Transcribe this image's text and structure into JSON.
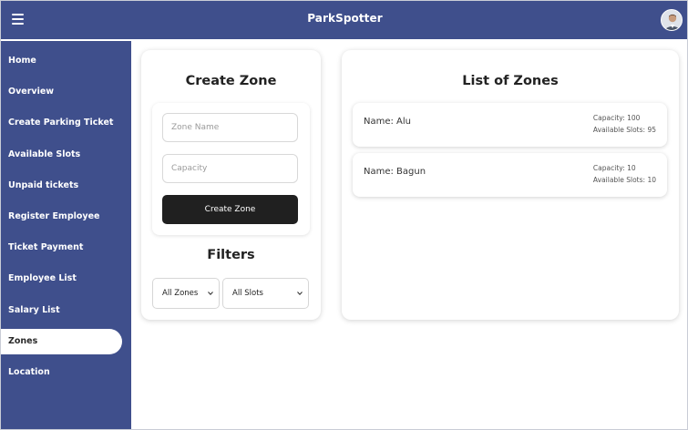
{
  "app": {
    "title": "ParkSpotter"
  },
  "sidebar": {
    "items": [
      {
        "label": "Home",
        "active": false
      },
      {
        "label": "Overview",
        "active": false
      },
      {
        "label": "Create Parking Ticket",
        "active": false
      },
      {
        "label": "Available Slots",
        "active": false
      },
      {
        "label": "Unpaid tickets",
        "active": false
      },
      {
        "label": "Register Employee",
        "active": false
      },
      {
        "label": "Ticket Payment",
        "active": false
      },
      {
        "label": "Employee List",
        "active": false
      },
      {
        "label": "Salary List",
        "active": false
      },
      {
        "label": "Zones",
        "active": true
      },
      {
        "label": "Location",
        "active": false
      }
    ]
  },
  "create_zone": {
    "title": "Create Zone",
    "zone_name_placeholder": "Zone Name",
    "capacity_placeholder": "Capacity",
    "submit_label": "Create Zone"
  },
  "filters": {
    "title": "Filters",
    "zone_select": "All Zones",
    "slot_select": "All Slots"
  },
  "zones_list": {
    "title": "List of Zones",
    "items": [
      {
        "name": "Name: Alu",
        "capacity": "Capacity: 100",
        "available": "Available Slots: 95"
      },
      {
        "name": "Name: Bagun",
        "capacity": "Capacity: 10",
        "available": "Available Slots: 10"
      }
    ]
  },
  "colors": {
    "brand": "#3f4f8c",
    "button": "#202020"
  },
  "icons": [
    "menu-icon",
    "avatar",
    "chevron-down-icon"
  ]
}
